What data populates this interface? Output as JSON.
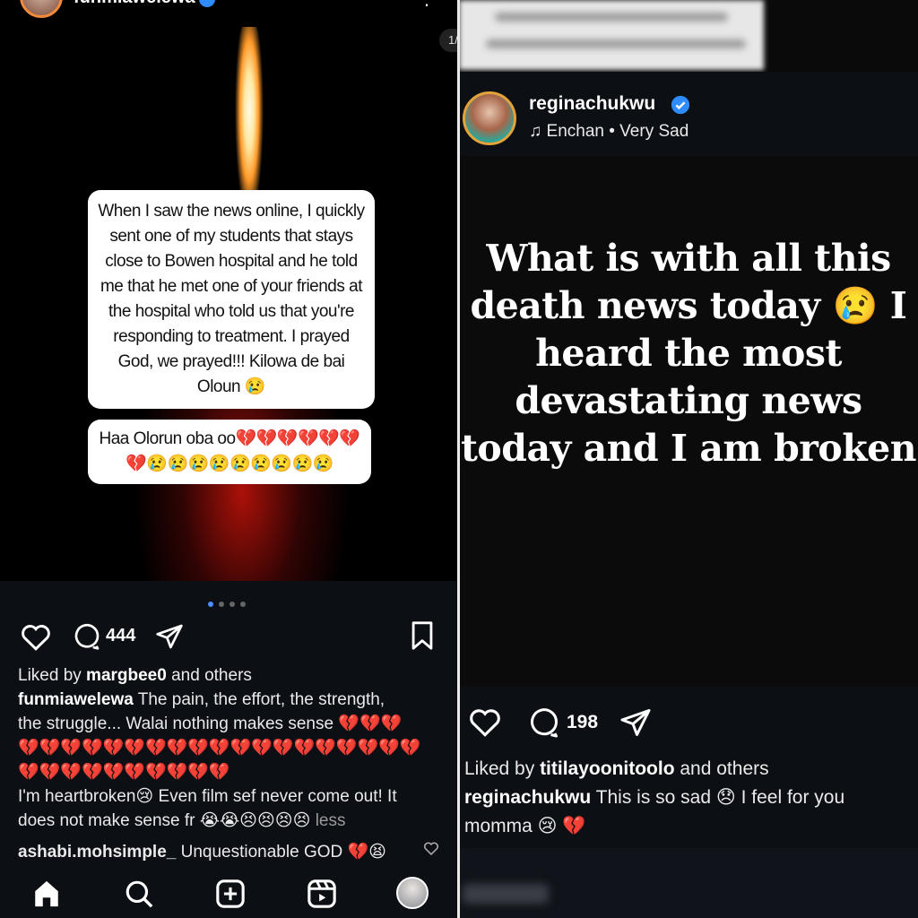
{
  "left_post": {
    "username": "funmiawelewa",
    "counter": "1/",
    "story_text_1": "When I saw the news online, I quickly sent one of my students that stays close to Bowen hospital and he told me that he met one of your friends at the hospital who told us that you're responding to treatment. I prayed God, we prayed!!! Kilowa de bai Oloun 😢",
    "story_text_2": "Haa Olorun oba oo💔💔💔💔💔💔💔😢😢😢😢😢😢😢😢😢",
    "comment_count": "444",
    "liked_by_prefix": "Liked by ",
    "liked_by_user": "margbee0",
    "liked_by_suffix": " and others",
    "caption_user": "funmiawelewa",
    "caption_line1": " The pain, the effort, the strength,",
    "caption_line2": "the struggle... Walai nothing makes sense 💔💔💔",
    "caption_line3": "💔💔💔💔💔💔💔💔💔💔💔💔💔💔💔💔💔💔💔",
    "caption_line4": "💔💔💔💔💔💔💔💔💔💔",
    "caption_line5": "I'm heartbroken😢 Even film sef never come out! It",
    "caption_line6": "does not make sense fr 😭😭😣😣😣😣 ",
    "less_label": "less",
    "comment_user": "ashabi.mohsimple_",
    "comment_text": " Unquestionable GOD 💔😫",
    "carousel_dots": 4,
    "carousel_active": 0
  },
  "right_post": {
    "username": "reginachukwu",
    "music": "Enchan • Very Sad",
    "post_text": "What is with all this death news today 😢 I heard the most devastating news today and I am broken",
    "comment_count": "198",
    "liked_by_prefix": "Liked by ",
    "liked_by_user": "titilayoonitoolo",
    "liked_by_suffix": " and others",
    "caption_user": "reginachukwu",
    "caption_text": " This is so sad 😞 I feel for you momma 😢 💔"
  },
  "icons": {
    "nav": [
      "home-icon",
      "search-icon",
      "create-icon",
      "reels-icon",
      "profile-avatar"
    ],
    "actions": [
      "heart-icon",
      "comment-icon",
      "share-icon",
      "bookmark-icon"
    ]
  },
  "colors": {
    "background": "#0c0f14",
    "verified": "#2f8cff",
    "carousel_active": "#4d8dff",
    "muted": "#9a9a9a"
  }
}
